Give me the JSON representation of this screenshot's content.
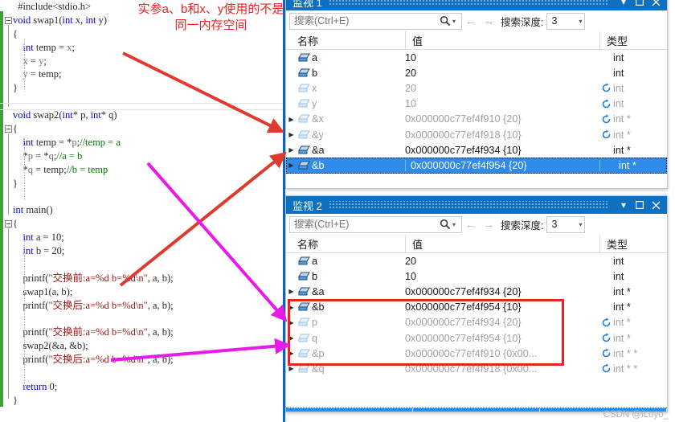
{
  "editor": {
    "language": "c",
    "lines": [
      [
        {
          "t": "  ",
          "c": "tokn"
        },
        {
          "t": "#include<stdio.h>",
          "c": "tokp"
        }
      ],
      [
        {
          "t": "void ",
          "c": "tokk"
        },
        {
          "t": "swap1",
          "c": "toki"
        },
        {
          "t": "(",
          "c": "tokn"
        },
        {
          "t": "int",
          "c": "tokk"
        },
        {
          "t": " x, ",
          "c": "toki"
        },
        {
          "t": "int",
          "c": "tokk"
        },
        {
          "t": " y)",
          "c": "toki"
        }
      ],
      [
        {
          "t": "{",
          "c": "tokn"
        }
      ],
      [
        {
          "t": "    ",
          "c": "tokn"
        },
        {
          "t": "int",
          "c": "tokk"
        },
        {
          "t": " temp = ",
          "c": "toki"
        },
        {
          "t": "x",
          "c": "tokg"
        },
        {
          "t": ";",
          "c": "tokn"
        }
      ],
      [
        {
          "t": "    ",
          "c": "tokn"
        },
        {
          "t": "x",
          "c": "tokg"
        },
        {
          "t": " = ",
          "c": "toki"
        },
        {
          "t": "y",
          "c": "tokg"
        },
        {
          "t": ";",
          "c": "tokn"
        }
      ],
      [
        {
          "t": "    ",
          "c": "tokn"
        },
        {
          "t": "y",
          "c": "tokg"
        },
        {
          "t": " = temp;",
          "c": "toki"
        }
      ],
      [
        {
          "t": "}",
          "c": "tokn"
        }
      ],
      [
        {
          "t": "",
          "c": "tokn"
        }
      ],
      [
        {
          "t": "void ",
          "c": "tokk"
        },
        {
          "t": "swap2",
          "c": "toki"
        },
        {
          "t": "(",
          "c": "tokn"
        },
        {
          "t": "int",
          "c": "tokk"
        },
        {
          "t": "* p, ",
          "c": "toki"
        },
        {
          "t": "int",
          "c": "tokk"
        },
        {
          "t": "* q)",
          "c": "toki"
        }
      ],
      [
        {
          "t": "{",
          "c": "tokn"
        }
      ],
      [
        {
          "t": "    ",
          "c": "tokn"
        },
        {
          "t": "int",
          "c": "tokk"
        },
        {
          "t": " temp = *",
          "c": "toki"
        },
        {
          "t": "p",
          "c": "tokg"
        },
        {
          "t": ";",
          "c": "tokn"
        },
        {
          "t": "//temp = a",
          "c": "tokc"
        }
      ],
      [
        {
          "t": "    *",
          "c": "tokn"
        },
        {
          "t": "p",
          "c": "tokg"
        },
        {
          "t": " = *",
          "c": "toki"
        },
        {
          "t": "q",
          "c": "tokg"
        },
        {
          "t": ";",
          "c": "tokn"
        },
        {
          "t": "//a = b",
          "c": "tokc"
        }
      ],
      [
        {
          "t": "    *",
          "c": "tokn"
        },
        {
          "t": "q",
          "c": "tokg"
        },
        {
          "t": " = temp;",
          "c": "toki"
        },
        {
          "t": "//b = temp",
          "c": "tokc"
        }
      ],
      [
        {
          "t": "}",
          "c": "tokn"
        }
      ],
      [
        {
          "t": "",
          "c": "tokn"
        }
      ],
      [
        {
          "t": "int ",
          "c": "tokk"
        },
        {
          "t": "main",
          "c": "toki"
        },
        {
          "t": "()",
          "c": "tokn"
        }
      ],
      [
        {
          "t": "{",
          "c": "tokn"
        }
      ],
      [
        {
          "t": "    ",
          "c": "tokn"
        },
        {
          "t": "int",
          "c": "tokk"
        },
        {
          "t": " a = ",
          "c": "toki"
        },
        {
          "t": "10",
          "c": "tokn"
        },
        {
          "t": ";",
          "c": "tokn"
        }
      ],
      [
        {
          "t": "    ",
          "c": "tokn"
        },
        {
          "t": "int",
          "c": "tokk"
        },
        {
          "t": " b = ",
          "c": "toki"
        },
        {
          "t": "20",
          "c": "tokn"
        },
        {
          "t": ";",
          "c": "tokn"
        }
      ],
      [
        {
          "t": "",
          "c": "tokn"
        }
      ],
      [
        {
          "t": "    ",
          "c": "tokn"
        },
        {
          "t": "printf",
          "c": "toki"
        },
        {
          "t": "(",
          "c": "tokn"
        },
        {
          "t": "\"交换前:a=%d b=%d\\n\"",
          "c": "toks"
        },
        {
          "t": ", a, b);",
          "c": "toki"
        }
      ],
      [
        {
          "t": "    ",
          "c": "tokn"
        },
        {
          "t": "swap1",
          "c": "toki"
        },
        {
          "t": "(a, b);",
          "c": "toki"
        }
      ],
      [
        {
          "t": "    ",
          "c": "tokn"
        },
        {
          "t": "printf",
          "c": "toki"
        },
        {
          "t": "(",
          "c": "tokn"
        },
        {
          "t": "\"交换后:a=%d b=%d\\n\"",
          "c": "toks"
        },
        {
          "t": ", a, b);",
          "c": "toki"
        }
      ],
      [
        {
          "t": "",
          "c": "tokn"
        }
      ],
      [
        {
          "t": "    ",
          "c": "tokn"
        },
        {
          "t": "printf",
          "c": "toki"
        },
        {
          "t": "(",
          "c": "tokn"
        },
        {
          "t": "\"交换前:a=%d b=%d\\n\"",
          "c": "toks"
        },
        {
          "t": ", a, b);",
          "c": "toki"
        }
      ],
      [
        {
          "t": "    ",
          "c": "tokn"
        },
        {
          "t": "swap2",
          "c": "toki"
        },
        {
          "t": "(&a, &b);",
          "c": "toki"
        }
      ],
      [
        {
          "t": "    ",
          "c": "tokn"
        },
        {
          "t": "printf",
          "c": "toki"
        },
        {
          "t": "(",
          "c": "tokn"
        },
        {
          "t": "\"交换后:a=%d b=%d\\n\"",
          "c": "toks"
        },
        {
          "t": ", a, b);",
          "c": "toki"
        }
      ],
      [
        {
          "t": "",
          "c": "tokn"
        }
      ],
      [
        {
          "t": "    ",
          "c": "tokn"
        },
        {
          "t": "return ",
          "c": "tokk"
        },
        {
          "t": "0",
          "c": "tokn"
        },
        {
          "t": ";",
          "c": "tokn"
        }
      ],
      [
        {
          "t": "}",
          "c": "tokn"
        }
      ]
    ]
  },
  "annotation": {
    "text": "实参a、b和x、y使用的不是同一内存空间",
    "color": "#ee2222",
    "arrow_red": "#e03a2f",
    "arrow_magenta": "#e81ae8"
  },
  "watch1": {
    "title": "监视 1",
    "search": {
      "placeholder": "搜索(Ctrl+E)",
      "value": ""
    },
    "depth_label": "搜索深度:",
    "depth_value": "3",
    "columns": [
      "名称",
      "值",
      "类型"
    ],
    "rows": [
      {
        "name": "a",
        "value": "10",
        "type": "int",
        "dim": false,
        "expandable": false,
        "refresh": false,
        "selected": false
      },
      {
        "name": "b",
        "value": "20",
        "type": "int",
        "dim": false,
        "expandable": false,
        "refresh": false,
        "selected": false
      },
      {
        "name": "x",
        "value": "20",
        "type": "int",
        "dim": true,
        "expandable": false,
        "refresh": true,
        "selected": false
      },
      {
        "name": "y",
        "value": "10",
        "type": "int",
        "dim": true,
        "expandable": false,
        "refresh": true,
        "selected": false
      },
      {
        "name": "&x",
        "value": "0x000000c77ef4f910 {20}",
        "type": "int *",
        "dim": true,
        "expandable": true,
        "refresh": true,
        "selected": false
      },
      {
        "name": "&y",
        "value": "0x000000c77ef4f918 {10}",
        "type": "int *",
        "dim": true,
        "expandable": true,
        "refresh": true,
        "selected": false
      },
      {
        "name": "&a",
        "value": "0x000000c77ef4f934 {10}",
        "type": "int *",
        "dim": false,
        "expandable": true,
        "refresh": false,
        "selected": false
      },
      {
        "name": "&b",
        "value": "0x000000c77ef4f954 {20}",
        "type": "int *",
        "dim": false,
        "expandable": true,
        "refresh": false,
        "selected": true
      }
    ]
  },
  "watch2": {
    "title": "监视 2",
    "search": {
      "placeholder": "搜索(Ctrl+E)",
      "value": ""
    },
    "depth_label": "搜索深度:",
    "depth_value": "3",
    "columns": [
      "名称",
      "值",
      "类型"
    ],
    "rows": [
      {
        "name": "a",
        "value": "20",
        "type": "int",
        "dim": false,
        "expandable": false,
        "refresh": false
      },
      {
        "name": "b",
        "value": "10",
        "type": "int",
        "dim": false,
        "expandable": false,
        "refresh": false
      },
      {
        "name": "&a",
        "value": "0x000000c77ef4f934 {20}",
        "type": "int *",
        "dim": false,
        "expandable": true,
        "refresh": false
      },
      {
        "name": "&b",
        "value": "0x000000c77ef4f954 {10}",
        "type": "int *",
        "dim": false,
        "expandable": true,
        "refresh": false
      },
      {
        "name": "p",
        "value": "0x000000c77ef4f934 {20}",
        "type": "int *",
        "dim": true,
        "expandable": true,
        "refresh": true
      },
      {
        "name": "q",
        "value": "0x000000c77ef4f954 {10}",
        "type": "int *",
        "dim": true,
        "expandable": true,
        "refresh": true
      },
      {
        "name": "&p",
        "value": "0x000000c77ef4f910 {0x00...",
        "type": "int * *",
        "dim": true,
        "expandable": true,
        "refresh": true
      },
      {
        "name": "&q",
        "value": "0x000000c77ef4f918 {0x00...",
        "type": "int * *",
        "dim": true,
        "expandable": true,
        "refresh": true
      }
    ],
    "highlight_color": "#e8241f"
  },
  "watermark": "CSDN @iLoyo_",
  "icons": {
    "search": "search-icon",
    "back": "back-arrow-icon",
    "forward": "forward-arrow-icon",
    "dropdown": "chevron-down-icon",
    "maximize": "maximize-icon",
    "close": "close-icon",
    "variable": "variable-box-icon",
    "refresh": "refresh-icon",
    "expander": "expander-triangle-icon"
  }
}
